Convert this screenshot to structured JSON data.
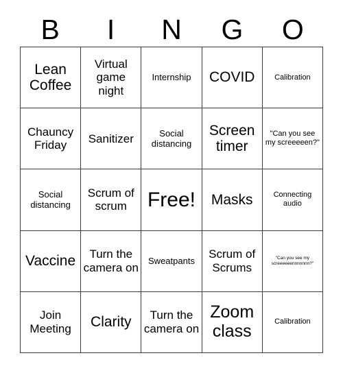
{
  "card": {
    "header_letters": [
      "B",
      "I",
      "N",
      "G",
      "O"
    ],
    "columns": 5,
    "rows": 5,
    "border_color": "#3a3a3a",
    "background_color": "#ffffff",
    "text_color": "#000000",
    "cells": [
      [
        {
          "text": "Lean Coffee",
          "size": "lg"
        },
        {
          "text": "Virtual game night",
          "size": "md"
        },
        {
          "text": "Internship",
          "size": "sm"
        },
        {
          "text": "COVID",
          "size": "lg"
        },
        {
          "text": "Calibration",
          "size": "xs"
        }
      ],
      [
        {
          "text": "Chauncy Friday",
          "size": "md"
        },
        {
          "text": "Sanitizer",
          "size": "md"
        },
        {
          "text": "Social distancing",
          "size": "sm"
        },
        {
          "text": "Screen timer",
          "size": "lg"
        },
        {
          "text": "\"Can you see my screeeeen?\"",
          "size": "xs"
        }
      ],
      [
        {
          "text": "Social distancing",
          "size": "sm"
        },
        {
          "text": "Scrum of scrum",
          "size": "md"
        },
        {
          "text": "Free!",
          "size": "xxl"
        },
        {
          "text": "Masks",
          "size": "lg"
        },
        {
          "text": "Connecting audio",
          "size": "xs"
        }
      ],
      [
        {
          "text": "Vaccine",
          "size": "lg"
        },
        {
          "text": "Turn the camera on",
          "size": "md"
        },
        {
          "text": "Sweatpants",
          "size": "sm"
        },
        {
          "text": "Scrum of Scrums",
          "size": "md"
        },
        {
          "text": "\"Can you see my screeeeeennnnnnn?\"",
          "size": "tiny"
        }
      ],
      [
        {
          "text": "Join Meeting",
          "size": "md"
        },
        {
          "text": "Clarity",
          "size": "lg"
        },
        {
          "text": "Turn the camera on",
          "size": "md"
        },
        {
          "text": "Zoom class",
          "size": "xl"
        },
        {
          "text": "Calibration",
          "size": "xs"
        }
      ]
    ]
  }
}
